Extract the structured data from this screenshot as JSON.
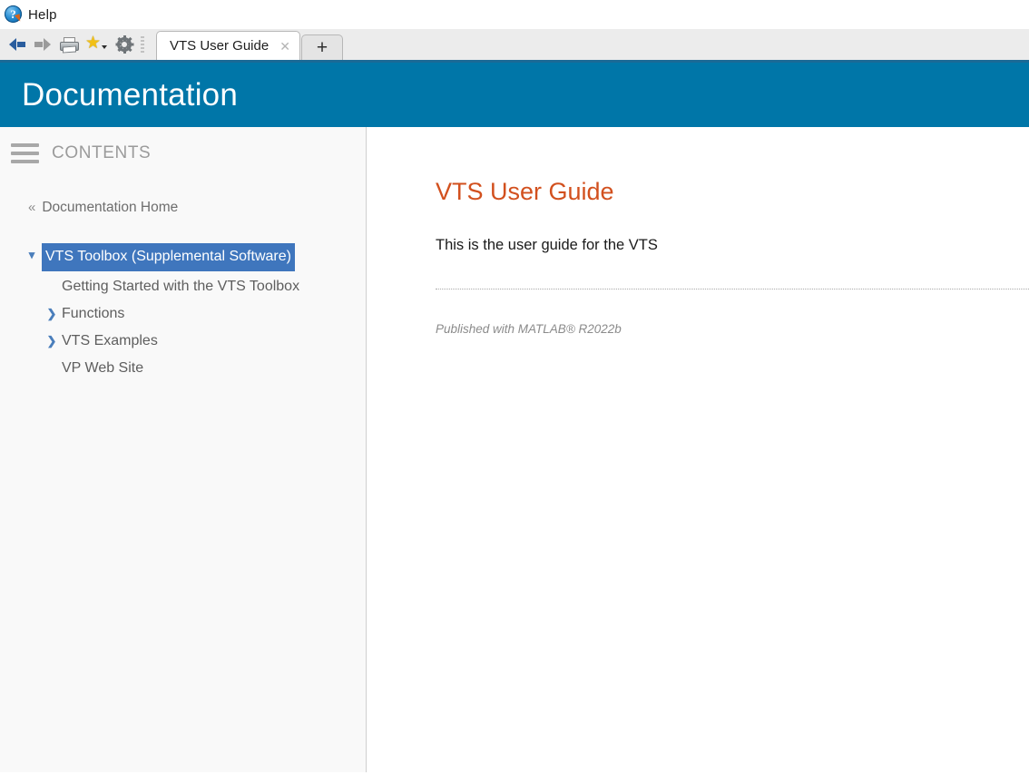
{
  "window": {
    "title": "Help",
    "app_icon": "help-question-icon"
  },
  "toolbar": {
    "back_icon": "back-arrow-icon",
    "forward_icon": "forward-arrow-icon",
    "print_icon": "printer-icon",
    "favorites_icon": "star-icon",
    "favorites_caret_icon": "caret-down-icon",
    "settings_icon": "gear-icon",
    "grip_icon": "toolbar-grip-icon"
  },
  "tabs": {
    "items": [
      {
        "label": "VTS User Guide",
        "close_glyph": "✕",
        "active": true
      }
    ],
    "new_tab_glyph": "+"
  },
  "header": {
    "title": "Documentation",
    "background_color": "#0076a8"
  },
  "sidebar": {
    "contents_label": "CONTENTS",
    "hamburger_icon": "hamburger-menu-icon",
    "home": {
      "chevron_glyph": "«",
      "label": "Documentation Home"
    },
    "tree": [
      {
        "label": "VTS Toolbox (Supplemental Software)",
        "twisty_glyph": "❯",
        "twisty_state": "expanded",
        "level": 1,
        "selected": true
      },
      {
        "label": "Getting Started with the VTS Toolbox",
        "twisty_glyph": "",
        "twisty_state": "none",
        "level": 2,
        "selected": false
      },
      {
        "label": "Functions",
        "twisty_glyph": "❯",
        "twisty_state": "collapsed",
        "level": 1,
        "selected": false
      },
      {
        "label": "VTS Examples",
        "twisty_glyph": "❯",
        "twisty_state": "collapsed",
        "level": 1,
        "selected": false
      },
      {
        "label": "VP Web Site",
        "twisty_glyph": "",
        "twisty_state": "none",
        "level": 2,
        "selected": false
      }
    ],
    "selected_color": "#3f76bd"
  },
  "main": {
    "title": "VTS User Guide",
    "title_color": "#d2501e",
    "paragraph": "This is the user guide for the VTS",
    "footer": "Published with MATLAB® R2022b"
  }
}
